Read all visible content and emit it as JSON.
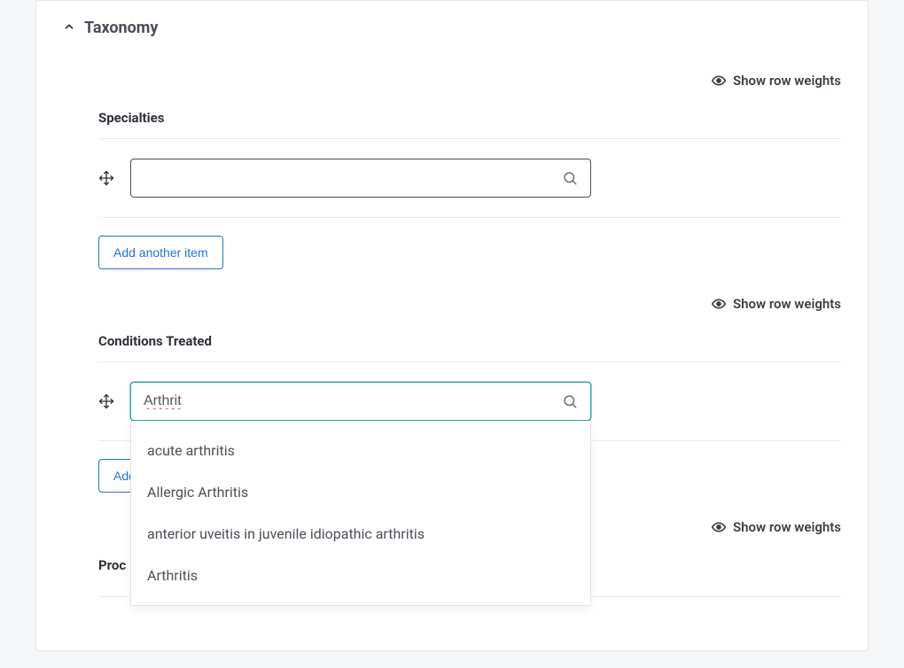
{
  "card": {
    "title": "Taxonomy"
  },
  "specialties": {
    "showWeightsLabel": "Show row weights",
    "label": "Specialties",
    "inputValue": "",
    "addItemLabel": "Add another item"
  },
  "conditions": {
    "showWeightsLabel": "Show row weights",
    "label": "Conditions Treated",
    "inputValue": "Arthrit",
    "addItemLabelPartial": "Add a",
    "suggestions": [
      "acute arthritis",
      "Allergic Arthritis",
      "anterior uveitis in juvenile idiopathic arthritis",
      "Arthritis"
    ]
  },
  "procedures": {
    "showWeightsLabel": "Show row weights",
    "labelPartial": "Proc"
  }
}
